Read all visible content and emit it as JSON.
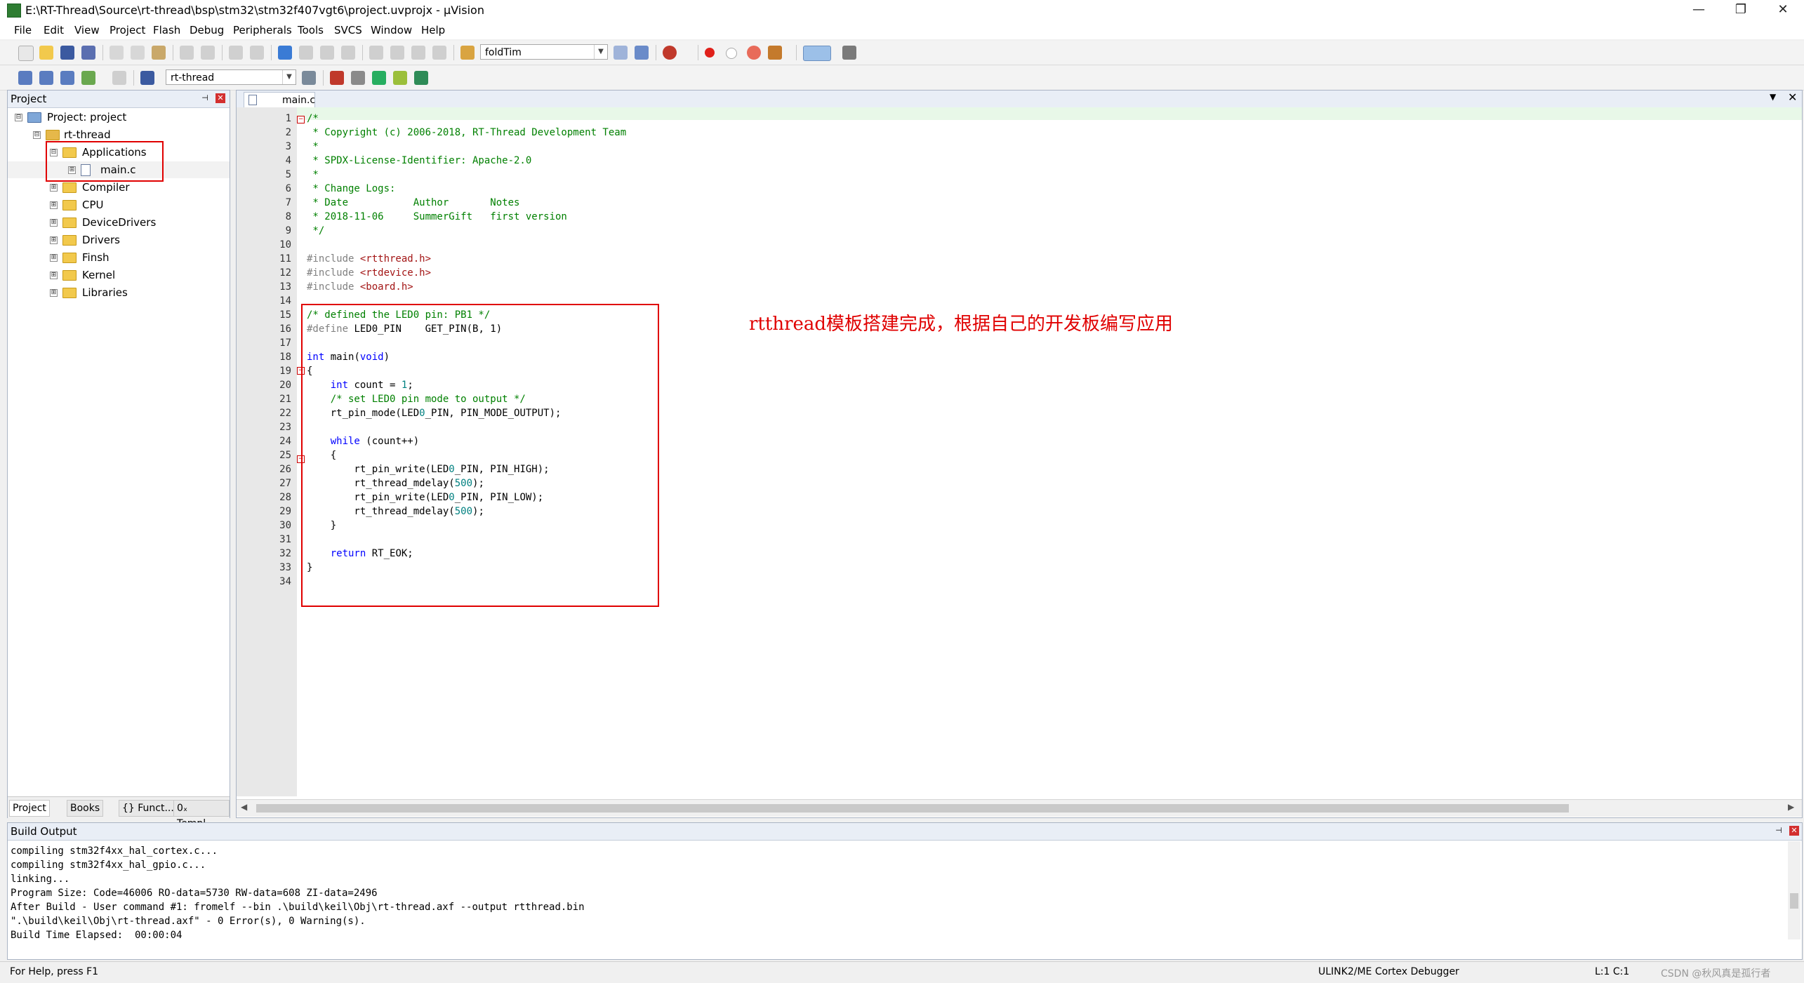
{
  "window": {
    "title": "E:\\RT-Thread\\Source\\rt-thread\\bsp\\stm32\\stm32f407vgt6\\project.uvprojx - µVision",
    "minimize": "—",
    "maximize": "❐",
    "close": "✕"
  },
  "menu": [
    "File",
    "Edit",
    "View",
    "Project",
    "Flash",
    "Debug",
    "Peripherals",
    "Tools",
    "SVCS",
    "Window",
    "Help"
  ],
  "toolbar": {
    "find_combo": "foldTim",
    "target_combo": "rt-thread"
  },
  "project_panel": {
    "title": "Project",
    "tree": [
      {
        "label": "Project: project",
        "depth": 0,
        "expander": "⊟"
      },
      {
        "label": "rt-thread",
        "depth": 1,
        "expander": "⊟"
      },
      {
        "label": "Applications",
        "depth": 2,
        "expander": "⊟"
      },
      {
        "label": "main.c",
        "depth": 3,
        "expander": "⊞"
      },
      {
        "label": "Compiler",
        "depth": 2,
        "expander": "⊞"
      },
      {
        "label": "CPU",
        "depth": 2,
        "expander": "⊞"
      },
      {
        "label": "DeviceDrivers",
        "depth": 2,
        "expander": "⊞"
      },
      {
        "label": "Drivers",
        "depth": 2,
        "expander": "⊞"
      },
      {
        "label": "Finsh",
        "depth": 2,
        "expander": "⊞"
      },
      {
        "label": "Kernel",
        "depth": 2,
        "expander": "⊞"
      },
      {
        "label": "Libraries",
        "depth": 2,
        "expander": "⊞"
      }
    ],
    "bottom_tabs": [
      "Project",
      "Books",
      "{} Funct...",
      "0ₓ Templ..."
    ]
  },
  "editor": {
    "tab": "main.c",
    "lines": [
      "/*",
      " * Copyright (c) 2006-2018, RT-Thread Development Team",
      " *",
      " * SPDX-License-Identifier: Apache-2.0",
      " *",
      " * Change Logs:",
      " * Date           Author       Notes",
      " * 2018-11-06     SummerGift   first version",
      " */",
      "",
      "#include <rtthread.h>",
      "#include <rtdevice.h>",
      "#include <board.h>",
      "",
      "/* defined the LED0 pin: PB1 */",
      "#define LED0_PIN    GET_PIN(B, 1)",
      "",
      "int main(void)",
      "{",
      "    int count = 1;",
      "    /* set LED0 pin mode to output */",
      "    rt_pin_mode(LED0_PIN, PIN_MODE_OUTPUT);",
      "",
      "    while (count++)",
      "    {",
      "        rt_pin_write(LED0_PIN, PIN_HIGH);",
      "        rt_thread_mdelay(500);",
      "        rt_pin_write(LED0_PIN, PIN_LOW);",
      "        rt_thread_mdelay(500);",
      "    }",
      "",
      "    return RT_EOK;",
      "}",
      ""
    ],
    "annotation": "rtthread模板搭建完成，根据自己的开发板编写应用"
  },
  "build_output": {
    "title": "Build Output",
    "lines": [
      "compiling stm32f4xx_hal_cortex.c...",
      "compiling stm32f4xx_hal_gpio.c...",
      "linking...",
      "Program Size: Code=46006 RO-data=5730 RW-data=608 ZI-data=2496",
      "After Build - User command #1: fromelf --bin .\\build\\keil\\Obj\\rt-thread.axf --output rtthread.bin",
      "\".\\build\\keil\\Obj\\rt-thread.axf\" - 0 Error(s), 0 Warning(s).",
      "Build Time Elapsed:  00:00:04"
    ]
  },
  "status": {
    "help": "For Help, press F1",
    "debugger": "ULINK2/ME Cortex Debugger",
    "position": "L:1 C:1",
    "watermark": "CSDN @秋风真是孤行者"
  }
}
